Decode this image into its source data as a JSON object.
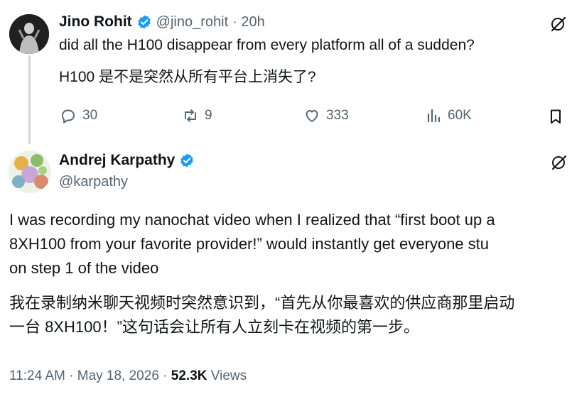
{
  "reply": {
    "author_name": "Jino Rohit",
    "handle": "@jino_rohit",
    "time": "· 20h",
    "text_en": "did all the H100 disappear from every platform all of a sudden?",
    "text_zh": "H100 是不是突然从所有平台上消失了?",
    "actions": {
      "replies": "30",
      "reposts": "9",
      "likes": "333",
      "views": "60K"
    }
  },
  "main": {
    "author_name": "Andrej Karpathy",
    "handle": "@karpathy",
    "text_en_lines": [
      "I was recording my nanochat video when I realized that “first boot up a",
      "8XH100 from your favorite provider!” would instantly get everyone stu",
      "on step 1 of the video"
    ],
    "text_zh_lines": [
      "我在录制纳米聊天视频时突然意识到，“首先从你最喜欢的供应商那里启动",
      "一台 8XH100！”这句话会让所有人立刻卡在视频的第一步。"
    ],
    "timestamp": "11:24 AM · May 18, 2026 · ",
    "views_count": "52.3K",
    "views_label": " Views"
  },
  "colors": {
    "text_primary": "#0f1419",
    "text_secondary": "#536471",
    "verified_blue": "#1d9bf0",
    "thread_line": "#cfd9de"
  },
  "icons": [
    "verified-badge-icon",
    "grok-icon",
    "reply-icon",
    "repost-icon",
    "like-icon",
    "views-icon",
    "bookmark-icon"
  ]
}
